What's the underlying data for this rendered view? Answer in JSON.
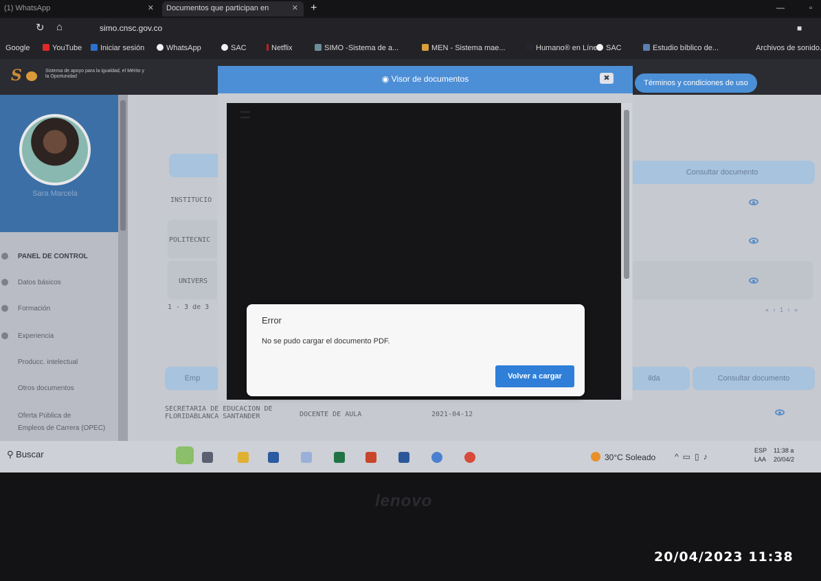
{
  "browser": {
    "tabs": [
      {
        "label": "(1) WhatsApp",
        "active": false
      },
      {
        "label": "Documentos que participan en",
        "active": true
      }
    ],
    "url": "simo.cnsc.gov.co",
    "bookmarks": [
      {
        "label": "Google",
        "icon": "google-icon"
      },
      {
        "label": "YouTube",
        "icon": "youtube-icon"
      },
      {
        "label": "Iniciar sesión",
        "icon": "outlook-icon"
      },
      {
        "label": "WhatsApp",
        "icon": "whatsapp-icon"
      },
      {
        "label": "SAC",
        "icon": "globe-icon"
      },
      {
        "label": "Netflix",
        "icon": "netflix-icon"
      },
      {
        "label": "SIMO -Sistema de a...",
        "icon": "simo-icon"
      },
      {
        "label": "MEN - Sistema mae...",
        "icon": "men-icon"
      },
      {
        "label": "Humano® en Línea",
        "icon": "humano-icon"
      },
      {
        "label": "SAC",
        "icon": "globe-icon"
      },
      {
        "label": "Estudio bíblico de...",
        "icon": "bible-icon"
      },
      {
        "label": "Archivos de sonido.",
        "icon": "folder-icon"
      }
    ]
  },
  "app": {
    "logo_text": "Sistema de apoyo para la igualdad, el Mérito y la Oportunidad",
    "terms_label": "Términos y condiciones de uso"
  },
  "sidebar": {
    "user_name": "Sara Marcela",
    "items": [
      {
        "label": "PANEL DE CONTROL"
      },
      {
        "label": "Datos básicos"
      },
      {
        "label": "Formación"
      },
      {
        "label": "Experiencia"
      },
      {
        "label": "Producc. intelectual"
      },
      {
        "label": "Otros documentos"
      },
      {
        "label": "Oferta Pública de"
      },
      {
        "label": "Empleos de Carrera (OPEC)"
      }
    ]
  },
  "formacion": {
    "header_consult": "Consultar documento",
    "rows": [
      {
        "label": "INSTITUCIO"
      },
      {
        "label": "POLITECNIC"
      },
      {
        "label": "UNIVERS"
      }
    ],
    "pagination": "1 - 3 de 3",
    "pager_controls": "« ‹ 1 › »"
  },
  "experiencia": {
    "header_empresa": "Emp",
    "header_salida": "ilda",
    "header_consult": "Consultar documento",
    "row": {
      "empresa": "SECRETARIA DE EDUCACION DE FLORIDABLANCA SANTANDER",
      "cargo": "DOCENTE DE AULA",
      "fecha": "2021-04-12"
    }
  },
  "modal": {
    "title": "Visor de documentos",
    "close_label": "✖"
  },
  "error": {
    "title": "Error",
    "message": "No se pudo cargar el documento PDF.",
    "button_label": "Volver a cargar"
  },
  "taskbar": {
    "search_label": "Buscar",
    "weather": "30°C  Soleado",
    "lang_top": "ESP",
    "lang_bottom": "LAA",
    "time": "11:38 a",
    "date": "20/04/2"
  },
  "bezel": {
    "brand": "lenovo",
    "photo_stamp": "20/04/2023  11:38"
  }
}
